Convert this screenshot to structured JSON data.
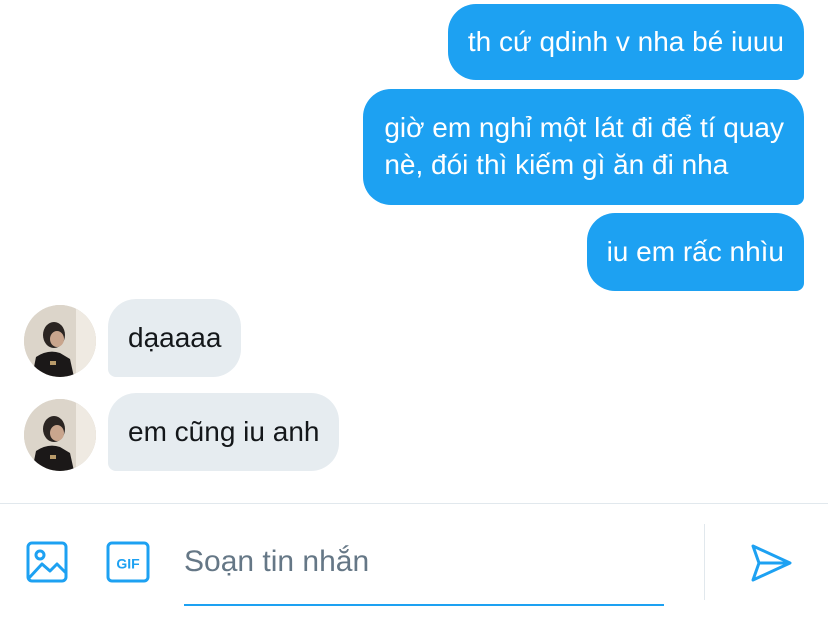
{
  "messages": {
    "outgoing": [
      {
        "text": "th cứ qdinh v nha bé iuuu"
      },
      {
        "line1": "giờ em nghỉ một lát đi để tí quay",
        "line2": "nè, đói thì kiếm gì ăn đi nha"
      },
      {
        "text": "iu em rấc nhìu"
      }
    ],
    "incoming": [
      {
        "text": "dạaaaa"
      },
      {
        "text": "em cũng iu anh"
      }
    ]
  },
  "composer": {
    "placeholder": "Soạn tin nhắn",
    "gif_label": "GIF",
    "icons": [
      "image-icon",
      "gif-icon",
      "send-icon"
    ]
  },
  "colors": {
    "accent": "#1da1f2",
    "incoming_bubble": "#e6ecf0",
    "placeholder": "#657786"
  }
}
